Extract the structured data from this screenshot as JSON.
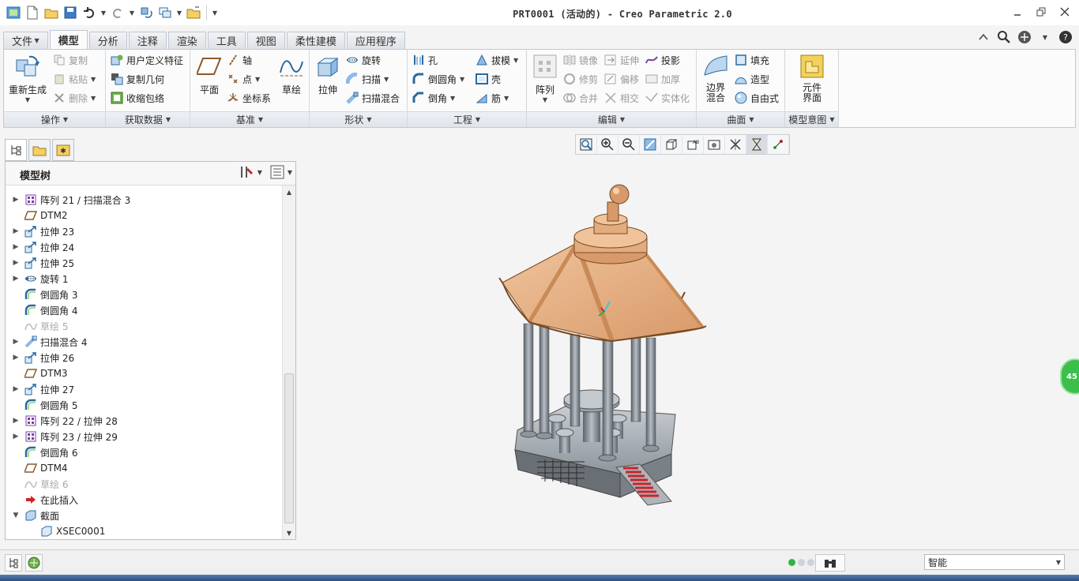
{
  "window": {
    "title": "PRT0001 (活动的) - Creo Parametric 2.0"
  },
  "ribbon_tabs": [
    {
      "label": "文件",
      "dropdown": true
    },
    {
      "label": "模型",
      "active": true
    },
    {
      "label": "分析"
    },
    {
      "label": "注释"
    },
    {
      "label": "渲染"
    },
    {
      "label": "工具"
    },
    {
      "label": "视图"
    },
    {
      "label": "柔性建模"
    },
    {
      "label": "应用程序"
    }
  ],
  "groups": {
    "operations": {
      "label": "操作",
      "regenerate": "重新生成",
      "copy": "复制",
      "paste": "粘贴",
      "delete": "删除"
    },
    "get_data": {
      "label": "获取数据",
      "udf": "用户定义特征",
      "copy_geom": "复制几何",
      "shrinkwrap": "收缩包络"
    },
    "datum": {
      "label": "基准",
      "plane": "平面",
      "axis": "轴",
      "point": "点",
      "csys": "坐标系",
      "sketch": "草绘"
    },
    "shapes": {
      "label": "形状",
      "extrude": "拉伸",
      "revolve": "旋转",
      "sweep": "扫描",
      "swept_blend": "扫描混合"
    },
    "engineering": {
      "label": "工程",
      "hole": "孔",
      "draft": "拔模",
      "round": "倒圆角",
      "shell": "壳",
      "chamfer": "倒角",
      "rib": "筋"
    },
    "editing": {
      "label": "编辑",
      "pattern": "阵列",
      "mirror": "镜像",
      "extend": "延伸",
      "project": "投影",
      "trim": "修剪",
      "offset": "偏移",
      "thicken": "加厚",
      "merge": "合并",
      "intersect": "相交",
      "solidify": "实体化"
    },
    "surfaces": {
      "label": "曲面",
      "boundary_blend": "边界混合",
      "fill": "填充",
      "style": "造型",
      "freestyle": "自由式"
    },
    "model_intent": {
      "label": "模型意图",
      "component_interface": "元件界面"
    }
  },
  "model_tree": {
    "title": "模型树",
    "items": [
      {
        "label": "阵列 21 / 扫描混合 3",
        "icon": "pattern-icon",
        "expandable": true
      },
      {
        "label": "DTM2",
        "icon": "datum-plane-icon",
        "expandable": false
      },
      {
        "label": "拉伸 23",
        "icon": "extrude-icon",
        "expandable": true
      },
      {
        "label": "拉伸 24",
        "icon": "extrude-icon",
        "expandable": true
      },
      {
        "label": "拉伸 25",
        "icon": "extrude-icon",
        "expandable": true
      },
      {
        "label": "旋转 1",
        "icon": "revolve-icon",
        "expandable": true
      },
      {
        "label": "倒圆角 3",
        "icon": "round-icon",
        "expandable": false
      },
      {
        "label": "倒圆角 4",
        "icon": "round-icon",
        "expandable": false
      },
      {
        "label": "草绘 5",
        "icon": "sketch-icon",
        "expandable": false,
        "dim": true
      },
      {
        "label": "扫描混合 4",
        "icon": "swept-blend-icon",
        "expandable": true
      },
      {
        "label": "拉伸 26",
        "icon": "extrude-icon",
        "expandable": true
      },
      {
        "label": "DTM3",
        "icon": "datum-plane-icon",
        "expandable": false
      },
      {
        "label": "拉伸 27",
        "icon": "extrude-icon",
        "expandable": true
      },
      {
        "label": "倒圆角 5",
        "icon": "round-icon",
        "expandable": false
      },
      {
        "label": "阵列 22 / 拉伸 28",
        "icon": "pattern-icon",
        "expandable": true
      },
      {
        "label": "阵列 23 / 拉伸 29",
        "icon": "pattern-icon",
        "expandable": true
      },
      {
        "label": "倒圆角 6",
        "icon": "round-icon",
        "expandable": false
      },
      {
        "label": "DTM4",
        "icon": "datum-plane-icon",
        "expandable": false
      },
      {
        "label": "草绘 6",
        "icon": "sketch-icon",
        "expandable": false,
        "dim": true
      },
      {
        "label": "在此插入",
        "icon": "insert-here-arrow-icon",
        "expandable": false
      },
      {
        "label": "截面",
        "icon": "section-folder-icon",
        "expandable": true,
        "expanded": true
      },
      {
        "label": "XSEC0001",
        "icon": "xsec-icon",
        "expandable": false,
        "indent": true
      }
    ]
  },
  "status": {
    "selection_filter": "智能"
  },
  "floating_badge": "45",
  "colors": {
    "roof": "#e8b48a",
    "column": "#8e959c",
    "stair": "#c4262c",
    "accent": "#2fb34a"
  }
}
